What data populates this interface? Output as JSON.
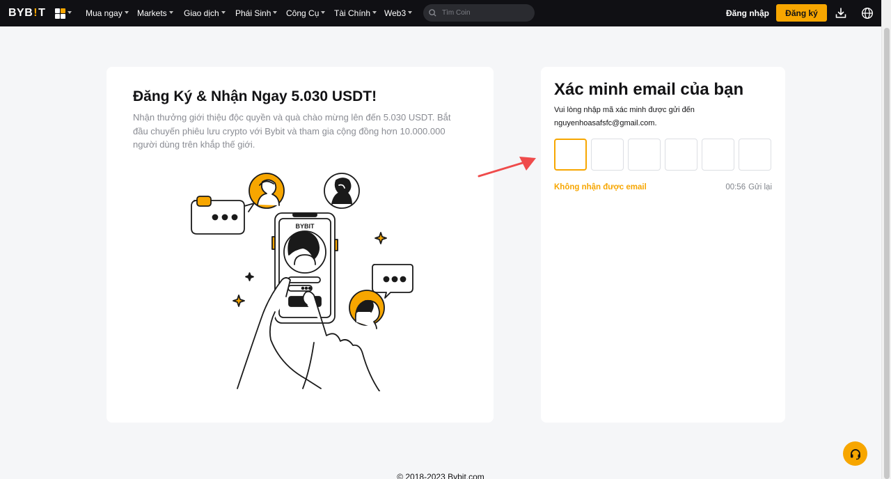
{
  "brand": {
    "logo_left": "BYB",
    "logo_bang": "!",
    "logo_right": "T",
    "accent": "#f7a600",
    "nav_bg": "#101014"
  },
  "nav": {
    "items": [
      {
        "label": "Mua ngay"
      },
      {
        "label": "Markets"
      },
      {
        "label": "Giao dịch"
      },
      {
        "label": "Phái Sinh"
      },
      {
        "label": "Công Cụ"
      },
      {
        "label": "Tài Chính"
      },
      {
        "label": "Web3"
      }
    ],
    "search_placeholder": "Tìm Coin",
    "login": "Đăng nhập",
    "signup": "Đăng ký",
    "icons": [
      "apps-grid-icon",
      "search-icon",
      "download-icon",
      "globe-icon"
    ]
  },
  "promo": {
    "title": "Đăng Ký & Nhận Ngay 5.030 USDT!",
    "description": "Nhận thưởng giới thiệu độc quyền và quà chào mừng lên đến 5.030 USDT. Bắt đầu chuyến phiêu lưu crypto với Bybit và tham gia cộng đồng hơn 10.000.000 người dùng trên khắp thế giới.",
    "phone_logo": "BYBIT"
  },
  "verify": {
    "title": "Xác minh email của bạn",
    "desc_line1": "Vui lòng nhập mã xác minh được gửi đến",
    "desc_line2": "nguyenhoasafsfc@gmail.com.",
    "code_length": 6,
    "no_email": "Không nhận được email",
    "timer": "00:56",
    "resend": "Gửi lại"
  },
  "footer": {
    "copyright": "© 2018-2023 Bybit.com"
  }
}
